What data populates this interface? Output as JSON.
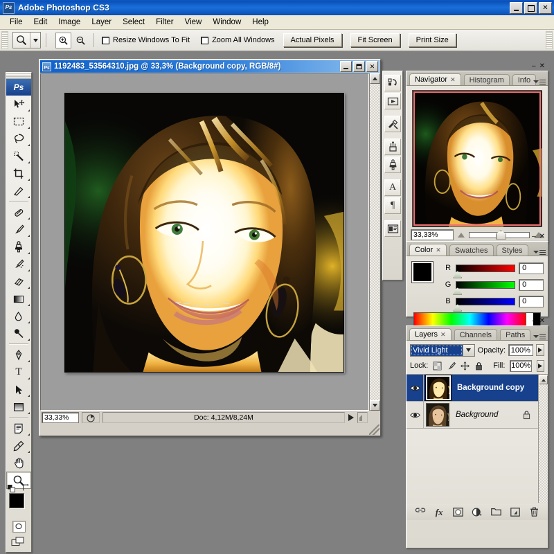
{
  "app": {
    "title": "Adobe Photoshop CS3",
    "icon": "photoshop-icon",
    "icon_text": "Ps"
  },
  "window_controls": {
    "minimize": "_",
    "maximize": "□",
    "close": "✕"
  },
  "menubar": {
    "items": [
      {
        "label": "File"
      },
      {
        "label": "Edit"
      },
      {
        "label": "Image"
      },
      {
        "label": "Layer"
      },
      {
        "label": "Select"
      },
      {
        "label": "Filter"
      },
      {
        "label": "View"
      },
      {
        "label": "Window"
      },
      {
        "label": "Help"
      }
    ]
  },
  "options_bar": {
    "active_tool": "zoom-tool",
    "zoom_in_label": "Zoom In",
    "zoom_out_label": "Zoom Out",
    "checkboxes": [
      {
        "label": "Resize Windows To Fit",
        "checked": false
      },
      {
        "label": "Zoom All Windows",
        "checked": false
      }
    ],
    "buttons": [
      {
        "label": "Actual Pixels"
      },
      {
        "label": "Fit Screen"
      },
      {
        "label": "Print Size"
      }
    ]
  },
  "toolbox": {
    "logo_text": "Ps",
    "tools": [
      {
        "name": "move-tool",
        "selected": false
      },
      {
        "name": "marquee-tool",
        "selected": false
      },
      {
        "name": "lasso-tool",
        "selected": false
      },
      {
        "name": "magic-wand-tool",
        "selected": false
      },
      {
        "name": "crop-tool",
        "selected": false
      },
      {
        "name": "slice-tool",
        "selected": false
      },
      {
        "name": "healing-brush-tool",
        "selected": false
      },
      {
        "name": "brush-tool",
        "selected": false
      },
      {
        "name": "clone-stamp-tool",
        "selected": false
      },
      {
        "name": "history-brush-tool",
        "selected": false
      },
      {
        "name": "eraser-tool",
        "selected": false
      },
      {
        "name": "gradient-tool",
        "selected": false
      },
      {
        "name": "blur-tool",
        "selected": false
      },
      {
        "name": "dodge-tool",
        "selected": false
      },
      {
        "name": "pen-tool",
        "selected": false
      },
      {
        "name": "type-tool",
        "selected": false
      },
      {
        "name": "path-selection-tool",
        "selected": false
      },
      {
        "name": "shape-tool",
        "selected": false
      },
      {
        "name": "notes-tool",
        "selected": false
      },
      {
        "name": "eyedropper-tool",
        "selected": false
      },
      {
        "name": "hand-tool",
        "selected": false
      },
      {
        "name": "zoom-tool",
        "selected": true
      }
    ],
    "foreground_color": "#000000",
    "background_color": "#ffffff",
    "quick_mask_label": "quick-mask-mode",
    "screen_mode_label": "screen-mode"
  },
  "document": {
    "title": "1192483_53564310.jpg @ 33,3% (Background copy, RGB/8#)",
    "filename": "1192483_53564310.jpg",
    "zoom_display": "33,3%",
    "layer_in_title": "Background copy",
    "color_mode": "RGB/8#",
    "statusbar": {
      "zoom_value": "33,33%",
      "doc_info": "Doc: 4,12M/8,24M",
      "preview_icon": "preview-arrow-icon"
    }
  },
  "dock_strip": {
    "items": [
      {
        "name": "history-icon"
      },
      {
        "name": "actions-play-icon"
      },
      {
        "name": "tool-presets-icon"
      },
      {
        "name": "brushes-icon"
      },
      {
        "name": "clone-source-icon"
      },
      {
        "name": "character-icon",
        "glyph": "A"
      },
      {
        "name": "paragraph-icon",
        "glyph": "¶"
      },
      {
        "name": "layer-comps-icon"
      }
    ]
  },
  "navigator_panel": {
    "tabs": [
      {
        "label": "Navigator",
        "active": true,
        "closable": true
      },
      {
        "label": "Histogram",
        "active": false,
        "closable": false
      },
      {
        "label": "Info",
        "active": false,
        "closable": false
      }
    ],
    "zoom_value": "33,33%",
    "zoom_out_icon": "small-mountain-icon",
    "zoom_in_icon": "large-mountain-icon",
    "view_box_color": "#f07070"
  },
  "color_panel": {
    "tabs": [
      {
        "label": "Color",
        "active": true,
        "closable": true
      },
      {
        "label": "Swatches",
        "active": false,
        "closable": false
      },
      {
        "label": "Styles",
        "active": false,
        "closable": false
      }
    ],
    "foreground": "#000000",
    "background": "#ffffff",
    "channels": [
      {
        "label": "R",
        "value": "0"
      },
      {
        "label": "G",
        "value": "0"
      },
      {
        "label": "B",
        "value": "0"
      }
    ]
  },
  "layers_panel": {
    "tabs": [
      {
        "label": "Layers",
        "active": true,
        "closable": true
      },
      {
        "label": "Channels",
        "active": false,
        "closable": false
      },
      {
        "label": "Paths",
        "active": false,
        "closable": false
      }
    ],
    "blend_mode": "Vivid Light",
    "opacity_label": "Opacity:",
    "opacity_value": "100%",
    "lock_label": "Lock:",
    "lock_icons": [
      {
        "name": "lock-transparent-pixels-icon"
      },
      {
        "name": "lock-image-pixels-icon"
      },
      {
        "name": "lock-position-icon"
      },
      {
        "name": "lock-all-icon"
      }
    ],
    "fill_label": "Fill:",
    "fill_value": "100%",
    "layers": [
      {
        "name": "Background copy",
        "selected": true,
        "visible": true,
        "locked": false,
        "italic": false
      },
      {
        "name": "Background",
        "selected": false,
        "visible": true,
        "locked": true,
        "italic": true
      }
    ],
    "footer_icons": [
      {
        "name": "link-layers-icon"
      },
      {
        "name": "layer-style-fx-icon"
      },
      {
        "name": "add-layer-mask-icon"
      },
      {
        "name": "adjustment-layer-icon"
      },
      {
        "name": "new-group-icon"
      },
      {
        "name": "new-layer-icon"
      },
      {
        "name": "delete-layer-icon"
      }
    ]
  }
}
